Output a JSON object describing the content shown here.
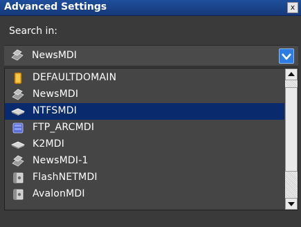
{
  "window": {
    "title": "Advanced Settings",
    "close_label": "x"
  },
  "search": {
    "label": "Search in:",
    "selected_location": "NewsMDI",
    "location_icon": "server-icon"
  },
  "list": {
    "items": [
      {
        "label": "DEFAULTDOMAIN",
        "icon": "domain-icon"
      },
      {
        "label": "NewsMDI",
        "icon": "server-icon"
      },
      {
        "label": "NTFSMDI",
        "icon": "drive-icon",
        "selected": true
      },
      {
        "label": "FTP_ARCMDI",
        "icon": "archive-icon"
      },
      {
        "label": "K2MDI",
        "icon": "drive-icon"
      },
      {
        "label": "NewsMDI-1",
        "icon": "server-icon"
      },
      {
        "label": "FlashNETMDI",
        "icon": "device-icon"
      },
      {
        "label": "AvalonMDI",
        "icon": "device-icon"
      }
    ]
  },
  "colors": {
    "titlebar": "#16397a",
    "background": "#3a3a3a",
    "selection": "#0a2a6e",
    "dropdown_accent": "#2d7de0"
  }
}
